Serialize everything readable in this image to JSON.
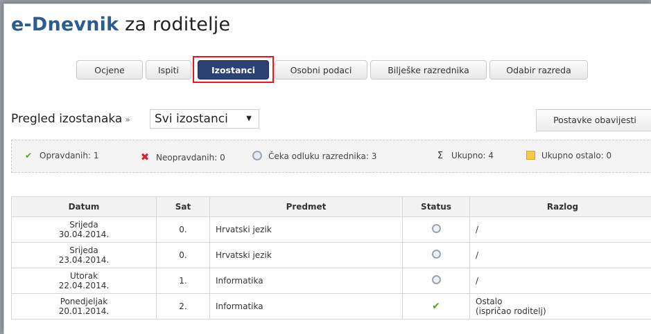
{
  "header": {
    "brand": "e-Dnevnik",
    "rest": " za roditelje"
  },
  "nav": {
    "tabs": [
      {
        "label": "Ocjene"
      },
      {
        "label": "Ispiti"
      },
      {
        "label": "Izostanci",
        "active": true
      },
      {
        "label": "Osobni podaci"
      },
      {
        "label": "Bilješke razrednika"
      },
      {
        "label": "Odabir razreda"
      }
    ]
  },
  "toolbar": {
    "heading": "Pregled izostanaka",
    "separator": "»",
    "filter_value": "Svi izostanci",
    "filter_arrow": "▼",
    "settings_button": "Postavke obavijesti"
  },
  "summary": {
    "opravdanih": "Opravdanih: 1",
    "neopravdanih": "Neopravdanih: 0",
    "ceka": "Čeka odluku razrednika: 3",
    "ukupno": "Ukupno: 4",
    "ukupno_ostalo": "Ukupno ostalo: 0"
  },
  "table": {
    "headers": {
      "datum": "Datum",
      "sat": "Sat",
      "predmet": "Predmet",
      "status": "Status",
      "razlog": "Razlog"
    },
    "rows": [
      {
        "day": "Srijeda",
        "date": "30.04.2014.",
        "sat": "0.",
        "predmet": "Hrvatski jezik",
        "status": "clock",
        "razlog": "/",
        "razlog2": ""
      },
      {
        "day": "Srijeda",
        "date": "23.04.2014.",
        "sat": "0.",
        "predmet": "Hrvatski jezik",
        "status": "clock",
        "razlog": "/",
        "razlog2": ""
      },
      {
        "day": "Utorak",
        "date": "22.04.2014.",
        "sat": "1.",
        "predmet": "Informatika",
        "status": "clock",
        "razlog": "/",
        "razlog2": ""
      },
      {
        "day": "Ponedjeljak",
        "date": "20.01.2014.",
        "sat": "2.",
        "predmet": "Informatika",
        "status": "check",
        "razlog": "Ostalo",
        "razlog2": "(ispričao roditelj)"
      }
    ]
  },
  "colors": {
    "brand": "#2b5c91",
    "active_tab": "#2d4174",
    "highlight": "#e0191d",
    "ok": "#4aa51d",
    "bad": "#d8232a"
  }
}
